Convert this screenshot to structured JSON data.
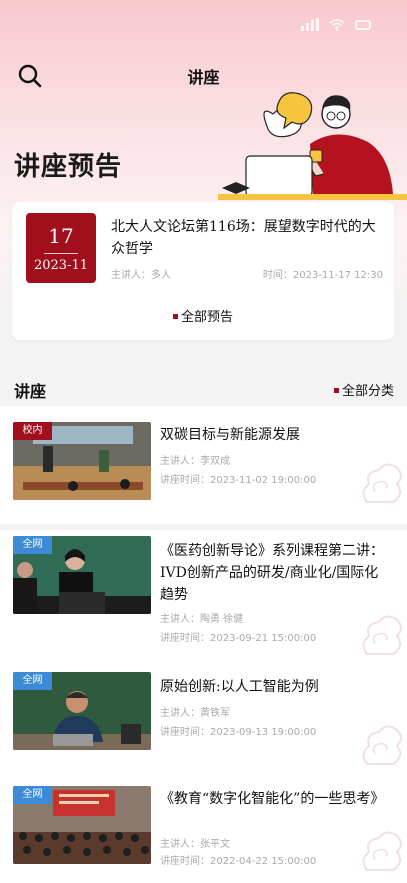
{
  "header": {
    "title": "讲座"
  },
  "hero": {
    "title": "讲座预告"
  },
  "preview": {
    "day": "17",
    "year_month": "2023-11",
    "title": "北大人文论坛第116场：展望数字时代的大众哲学",
    "speaker": "主讲人：多人",
    "time": "时间：2023-11-17 12:30",
    "all_label": "全部预告"
  },
  "section": {
    "title": "讲座",
    "category_label": "全部分类"
  },
  "lectures": [
    {
      "tag": "校内",
      "title": "双碳目标与新能源发展",
      "speaker": "主讲人：李双成",
      "time": "讲座时间：2023-11-02 19:00:00"
    },
    {
      "tag": "全网",
      "title": "《医药创新导论》系列课程第二讲：IVD创新产品的研发/商业化/国际化趋势",
      "speaker": "主讲人：陶勇  徐健",
      "time": "讲座时间：2023-09-21 15:00:00"
    },
    {
      "tag": "全网",
      "title": "原始创新:以人工智能为例",
      "speaker": "主讲人：黄铁军",
      "time": "讲座时间：2023-09-13 19:00:00"
    },
    {
      "tag": "全网",
      "title": "《教育“数字化智能化”的一些思考》",
      "speaker": "主讲人：张平文",
      "time": "讲座时间：2022-04-22 15:00:00"
    }
  ],
  "colors": {
    "accent": "#a10f1c",
    "tag_blue": "#3d8bd6"
  }
}
